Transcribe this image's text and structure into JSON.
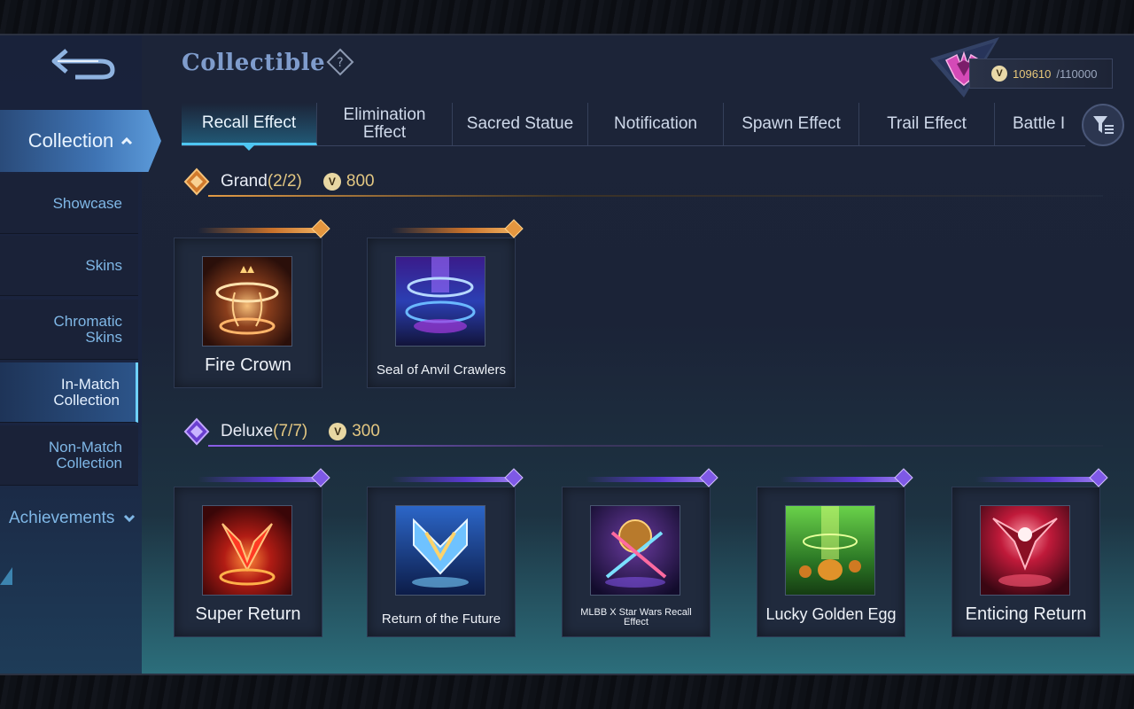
{
  "header": {
    "title": "Collectible",
    "points_current": "109610",
    "points_max": "/110000"
  },
  "sidebar": {
    "collection_label": "Collection",
    "items": [
      {
        "label": "Showcase"
      },
      {
        "label": "Skins"
      },
      {
        "label": "Chromatic\nSkins"
      },
      {
        "label": "In-Match\nCollection"
      },
      {
        "label": "Non-Match\nCollection"
      }
    ],
    "achievements_label": "Achievements"
  },
  "tabs": [
    {
      "label": "Recall Effect"
    },
    {
      "label": "Elimination\nEffect"
    },
    {
      "label": "Sacred Statue"
    },
    {
      "label": "Notification"
    },
    {
      "label": "Spawn Effect"
    },
    {
      "label": "Trail Effect"
    },
    {
      "label": "Battle I"
    }
  ],
  "sections": {
    "grand": {
      "name": "Grand",
      "count": "(2/2)",
      "price": "800",
      "items": [
        {
          "name": "Fire Crown"
        },
        {
          "name": "Seal of Anvil Crawlers"
        }
      ]
    },
    "deluxe": {
      "name": "Deluxe",
      "count": "(7/7)",
      "price": "300",
      "items": [
        {
          "name": "Super Return"
        },
        {
          "name": "Return of the Future"
        },
        {
          "name": "MLBB X Star Wars Recall Effect"
        },
        {
          "name": "Lucky Golden Egg"
        },
        {
          "name": "Enticing Return"
        }
      ]
    }
  },
  "colors": {
    "accent": "#4ec6f2",
    "grand": "#e19a45",
    "deluxe": "#8a5ee8",
    "coin_text": "#e3c782"
  }
}
